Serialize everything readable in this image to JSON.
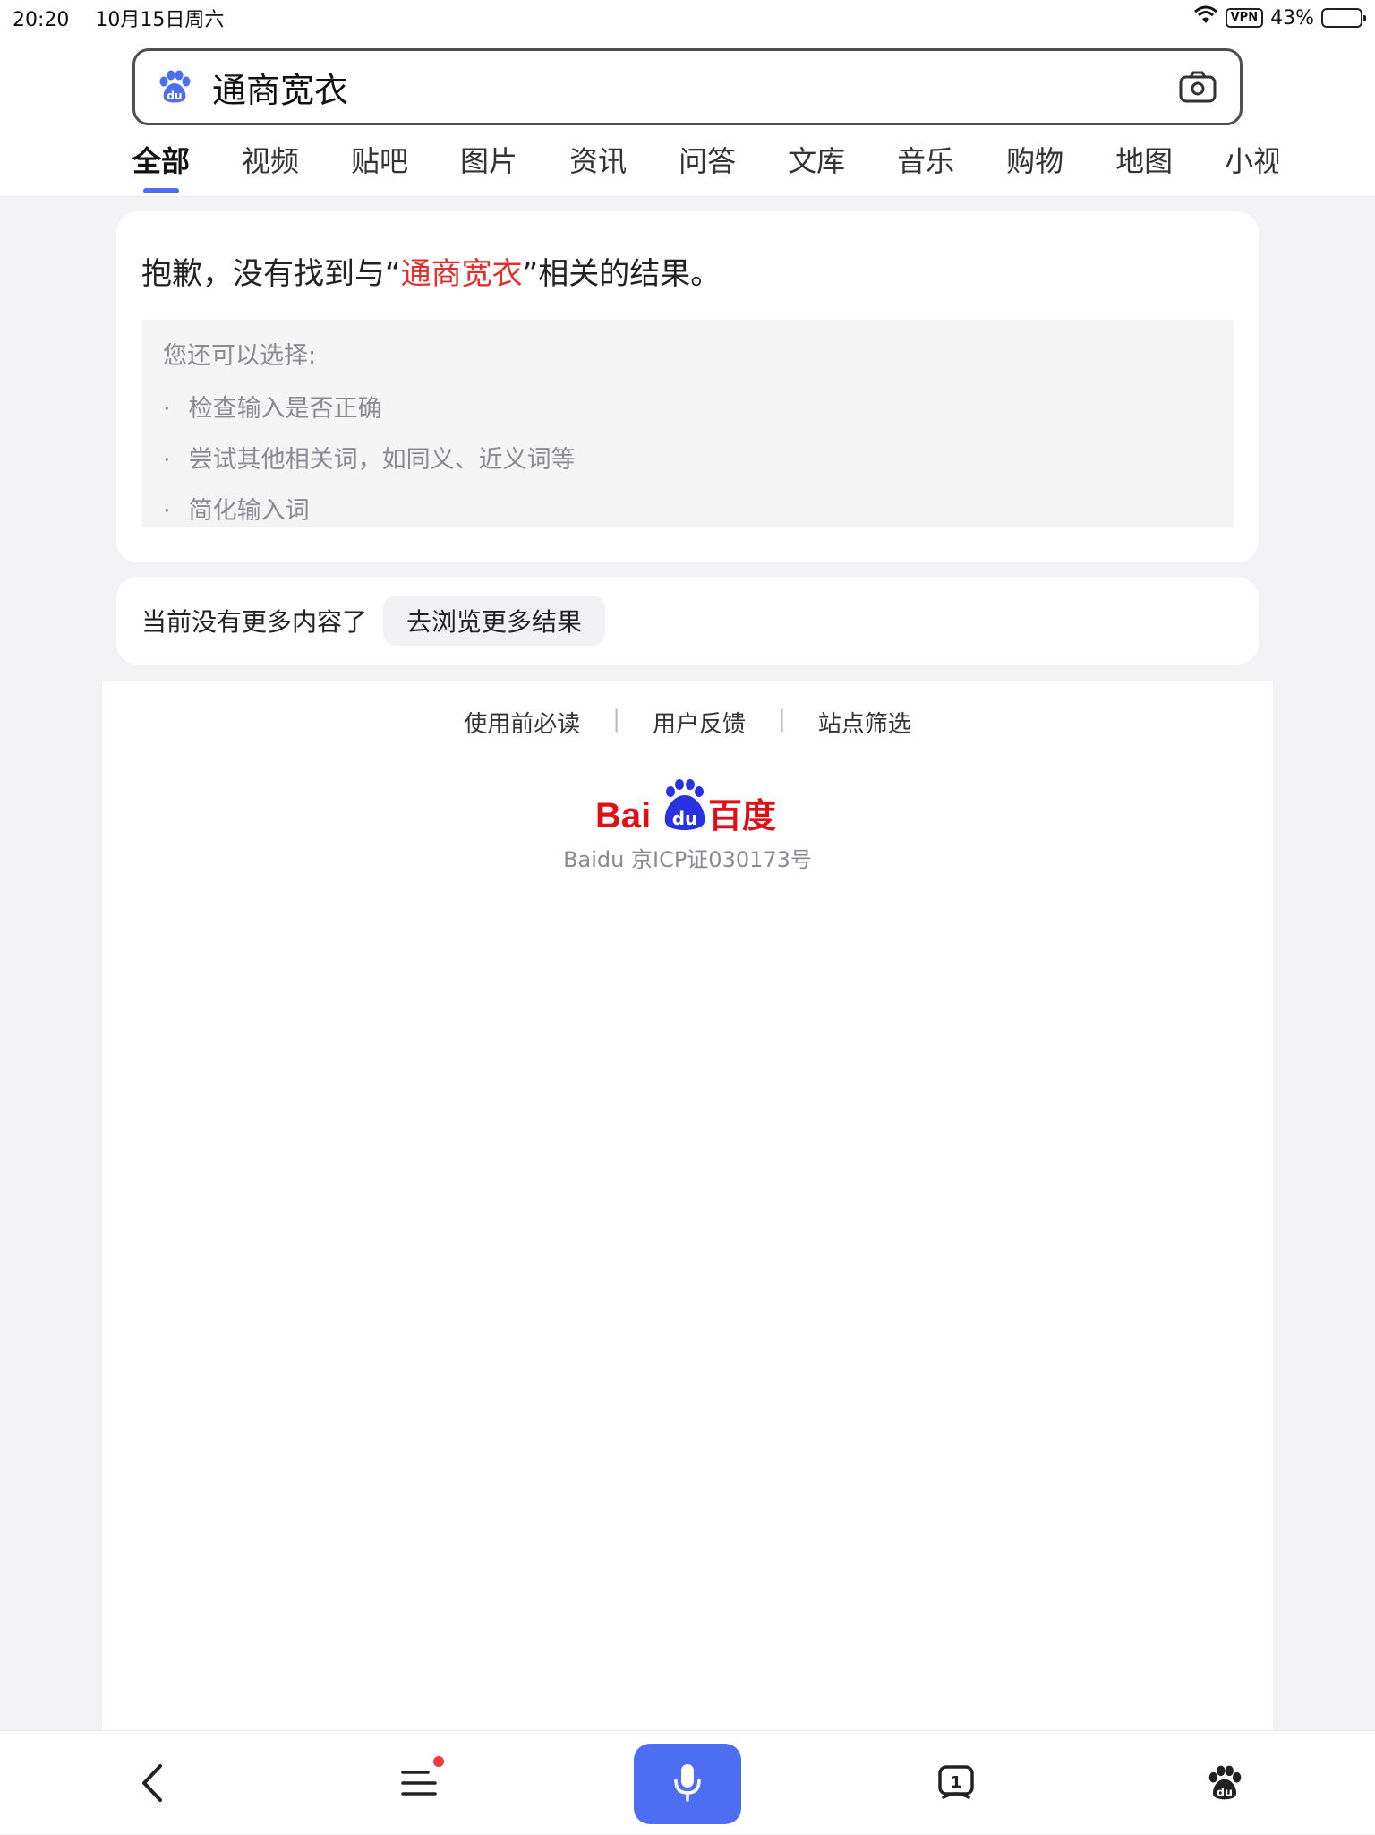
{
  "status_bar": {
    "time": "20:20",
    "date": "10月15日周六",
    "vpn": "VPN",
    "battery": "43%",
    "battery_level": 0.43
  },
  "search": {
    "query": "通商宽衣"
  },
  "tabs": [
    {
      "label": "全部",
      "active": true
    },
    {
      "label": "视频"
    },
    {
      "label": "贴吧"
    },
    {
      "label": "图片"
    },
    {
      "label": "资讯"
    },
    {
      "label": "问答"
    },
    {
      "label": "文库"
    },
    {
      "label": "音乐"
    },
    {
      "label": "购物"
    },
    {
      "label": "地图"
    },
    {
      "label": "小视"
    }
  ],
  "no_result": {
    "prefix": "抱歉，没有找到与“",
    "keyword": "通商宽衣",
    "suffix": "”相关的结果。",
    "suggest_title": "您还可以选择:",
    "suggestions": [
      "检查输入是否正确",
      "尝试其他相关词，如同义、近义词等",
      "简化输入词"
    ]
  },
  "more": {
    "note": "当前没有更多内容了",
    "button": "去浏览更多结果"
  },
  "footer": {
    "links": [
      "使用前必读",
      "用户反馈",
      "站点筛选"
    ],
    "logo_text_latin": "Bai",
    "logo_text_du": "du",
    "logo_text_cn": "百度",
    "icp": "Baidu 京ICP证030173号"
  },
  "bottom_bar": {
    "tab_count": "1"
  },
  "colors": {
    "accent": "#4e6ef2",
    "keyword_red": "#e0312e",
    "baidu_red": "#de0f17",
    "baidu_blue": "#2932e1"
  }
}
